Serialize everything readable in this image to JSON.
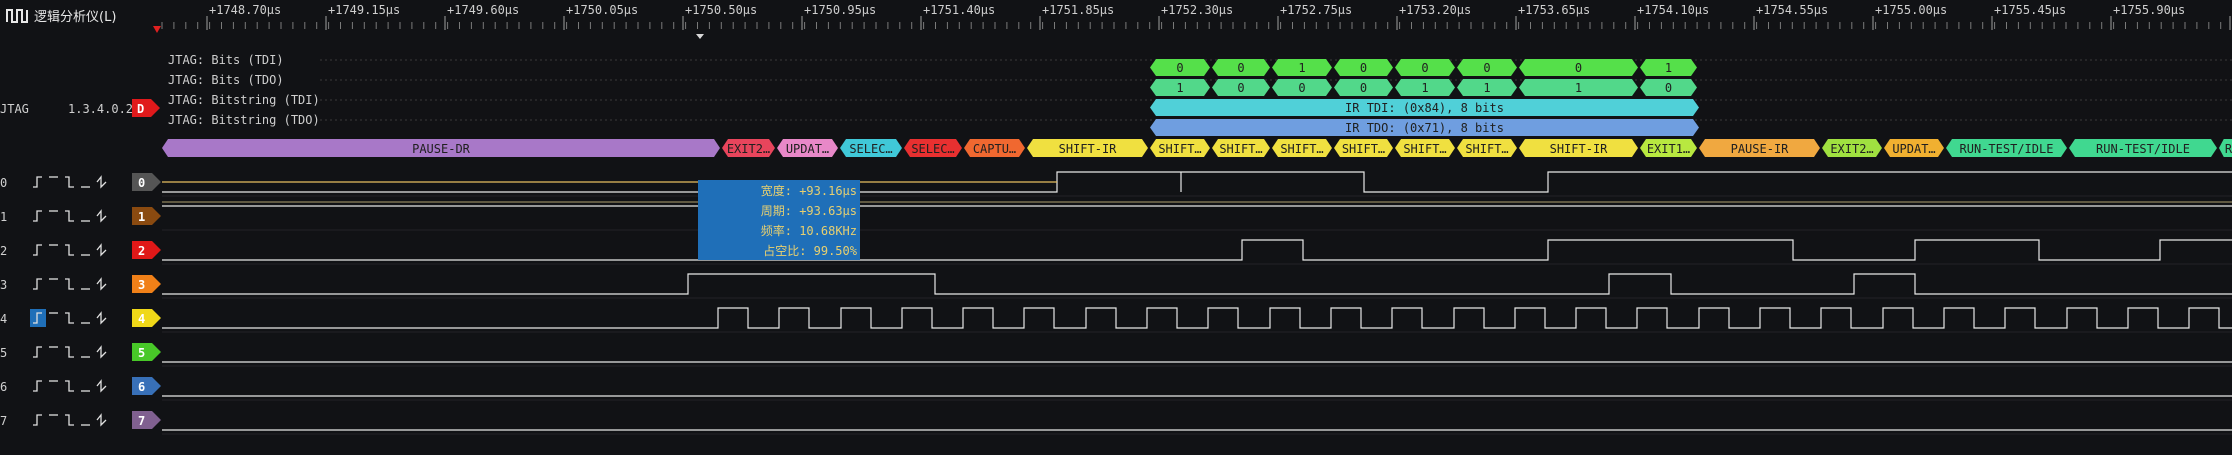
{
  "app": {
    "title": "逻辑分析仪(L)",
    "icon": "square-wave-icon"
  },
  "time_ruler": {
    "labels": [
      "+1748.70μs",
      "+1749.15μs",
      "+1749.60μs",
      "+1750.05μs",
      "+1750.50μs",
      "+1750.95μs",
      "+1751.40μs",
      "+1751.85μs",
      "+1752.30μs",
      "+1752.75μs",
      "+1753.20μs",
      "+1753.65μs",
      "+1754.10μs",
      "+1754.55μs",
      "+1755.00μs",
      "+1755.45μs",
      "+1755.90μs",
      "+1"
    ],
    "label_x": [
      1,
      0.4572,
      1
    ]
  },
  "decoder": {
    "name": "JTAG",
    "address": "1.3.4.0.2",
    "badge": "D",
    "badge_color": "#e0191b",
    "rows": [
      {
        "label": "JTAG: Bits (TDI)"
      },
      {
        "label": "JTAG: Bits (TDO)"
      },
      {
        "label": "JTAG: Bitstring (TDI)"
      },
      {
        "label": "JTAG: Bitstring (TDO)"
      }
    ],
    "tdi_bits": [
      "0",
      "0",
      "1",
      "0",
      "0",
      "0",
      "0",
      "1"
    ],
    "tdo_bits": [
      "1",
      "0",
      "0",
      "0",
      "1",
      "1",
      "1",
      "0"
    ],
    "tdi_string": "IR TDI:  (0x84), 8 bits",
    "tdo_string": "IR TDO:  (0x71), 8 bits",
    "states": [
      {
        "text": "PAUSE-DR",
        "color": "#a878c8"
      },
      {
        "text": "EXIT2…",
        "color": "#e8455c"
      },
      {
        "text": "UPDAT…",
        "color": "#e888c8"
      },
      {
        "text": "SELEC…",
        "color": "#40c8d8"
      },
      {
        "text": "SELEC…",
        "color": "#e83030"
      },
      {
        "text": "CAPTU…",
        "color": "#f06830"
      },
      {
        "text": "SHIFT-IR",
        "color": "#f0e040"
      },
      {
        "text": "SHIFT…",
        "color": "#f0e040"
      },
      {
        "text": "SHIFT…",
        "color": "#f0e040"
      },
      {
        "text": "SHIFT…",
        "color": "#f0e040"
      },
      {
        "text": "SHIFT…",
        "color": "#f0e040"
      },
      {
        "text": "SHIFT…",
        "color": "#f0e040"
      },
      {
        "text": "SHIFT…",
        "color": "#f0e040"
      },
      {
        "text": "SHIFT-IR",
        "color": "#f0e040"
      },
      {
        "text": "EXIT1…",
        "color": "#b8e840"
      },
      {
        "text": "PAUSE-IR",
        "color": "#f0a840"
      },
      {
        "text": "EXIT2…",
        "color": "#a0e040"
      },
      {
        "text": "UPDAT…",
        "color": "#f0b030"
      },
      {
        "text": "RUN-TEST/IDLE",
        "color": "#40d890"
      },
      {
        "text": "RUN-TEST/IDLE",
        "color": "#40d890"
      },
      {
        "text": "R",
        "color": "#40d890"
      }
    ]
  },
  "channels": [
    {
      "id": "0",
      "color": "#555555"
    },
    {
      "id": "1",
      "color": "#8a4a10"
    },
    {
      "id": "2",
      "color": "#e01818"
    },
    {
      "id": "3",
      "color": "#f08018"
    },
    {
      "id": "4",
      "color": "#f0d818"
    },
    {
      "id": "5",
      "color": "#48c828"
    },
    {
      "id": "6",
      "color": "#3870b8"
    },
    {
      "id": "7",
      "color": "#806090"
    }
  ],
  "trigger_icons": [
    "rising-edge-icon",
    "high-level-icon",
    "falling-edge-icon",
    "low-level-icon",
    "any-edge-icon"
  ],
  "measurement": {
    "width_label": "宽度: +93.16μs",
    "period_label": "周期: +93.63μs",
    "frequency_label": "频率: 10.68KHz",
    "duty_label": "占空比: 99.50%"
  },
  "colors": {
    "accent": "#1f6fb8",
    "trace": "#e8e8e8",
    "selected_trace": "#e8c060"
  }
}
